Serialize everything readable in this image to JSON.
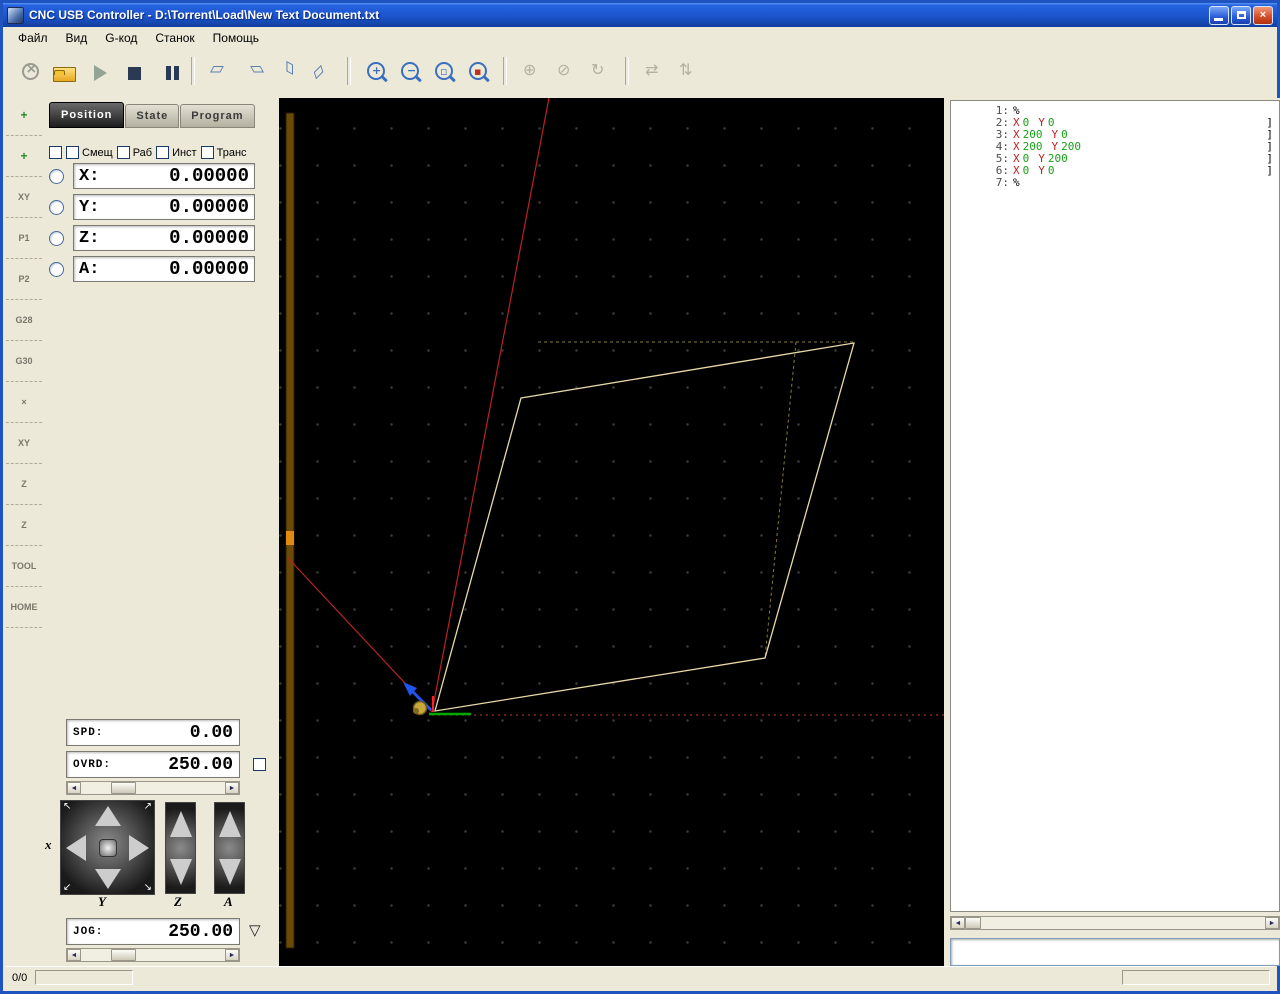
{
  "window": {
    "title": "CNC USB Controller - D:\\Torrent\\Load\\New Text Document.txt"
  },
  "menubar": {
    "items": [
      {
        "name": "menu-file",
        "label": "Файл"
      },
      {
        "name": "menu-view",
        "label": "Вид"
      },
      {
        "name": "menu-gcode",
        "label": "G-код"
      },
      {
        "name": "menu-machine",
        "label": "Станок"
      },
      {
        "name": "menu-help",
        "label": "Помощь"
      }
    ]
  },
  "toolbar": {
    "groups": [
      [
        {
          "name": "estop-icon",
          "kind": "estop",
          "disabled": true
        },
        {
          "name": "open-file-icon",
          "kind": "folder",
          "disabled": false
        },
        {
          "name": "start-icon",
          "kind": "play",
          "disabled": true
        },
        {
          "name": "stop-icon",
          "kind": "stop",
          "disabled": false
        },
        {
          "name": "pause-icon",
          "kind": "pause",
          "disabled": false
        }
      ],
      [
        {
          "name": "view-perspective-icon",
          "kind": "view1",
          "disabled": false
        },
        {
          "name": "view-top-icon",
          "kind": "view2",
          "disabled": false
        },
        {
          "name": "view-front-icon",
          "kind": "view3",
          "disabled": false
        },
        {
          "name": "view-side-icon",
          "kind": "view4",
          "disabled": false
        }
      ],
      [
        {
          "name": "zoom-in-icon",
          "kind": "zoomin",
          "disabled": false
        },
        {
          "name": "zoom-out-icon",
          "kind": "zoomout",
          "disabled": false
        },
        {
          "name": "zoom-window-icon",
          "kind": "zoomwin",
          "disabled": false
        },
        {
          "name": "zoom-tool-icon",
          "kind": "zoomtool",
          "disabled": false
        }
      ],
      [
        {
          "name": "simulate-icon",
          "kind": "g1",
          "disabled": true
        },
        {
          "name": "render-toolpath-icon",
          "kind": "g2",
          "disabled": true
        },
        {
          "name": "rotate-view-icon",
          "kind": "g3",
          "disabled": true
        }
      ],
      [
        {
          "name": "swap-axes-icon",
          "kind": "g4",
          "disabled": true
        },
        {
          "name": "machine-setup-icon",
          "kind": "g5",
          "disabled": true
        }
      ]
    ]
  },
  "sidebar": {
    "items": [
      {
        "name": "sidebar-add-position-1",
        "label": "+",
        "accent": "green"
      },
      {
        "name": "sidebar-add-position-2",
        "label": "+",
        "accent": "green"
      },
      {
        "name": "sidebar-goto-xy",
        "label": "XY"
      },
      {
        "name": "sidebar-goto-p1",
        "label": "P1"
      },
      {
        "name": "sidebar-goto-p2",
        "label": "P2"
      },
      {
        "name": "sidebar-goto-g28",
        "label": "G28"
      },
      {
        "name": "sidebar-goto-g30",
        "label": "G30"
      },
      {
        "name": "sidebar-zero-axes",
        "label": "×"
      },
      {
        "name": "sidebar-zero-xy",
        "label": "XY"
      },
      {
        "name": "sidebar-zero-z",
        "label": "Z"
      },
      {
        "name": "sidebar-measure-z",
        "label": "Z"
      },
      {
        "name": "sidebar-tool",
        "label": "TOOL"
      },
      {
        "name": "sidebar-home",
        "label": "HOME"
      }
    ]
  },
  "panel": {
    "tabs": [
      {
        "name": "tab-position",
        "label": "Position",
        "active": true
      },
      {
        "name": "tab-state",
        "label": "State",
        "active": false
      },
      {
        "name": "tab-program",
        "label": "Program",
        "active": false
      }
    ],
    "checkboxes": [
      {
        "name": "checkbox-main",
        "label": ""
      },
      {
        "name": "checkbox-offset",
        "label": "Смещ"
      },
      {
        "name": "checkbox-work",
        "label": "Раб"
      },
      {
        "name": "checkbox-tool",
        "label": "Инст"
      },
      {
        "name": "checkbox-trans",
        "label": "Транс"
      }
    ],
    "axes": [
      {
        "key": "x",
        "label": "X:",
        "value": "0.00000"
      },
      {
        "key": "y",
        "label": "Y:",
        "value": "0.00000"
      },
      {
        "key": "z",
        "label": "Z:",
        "value": "0.00000"
      },
      {
        "key": "a",
        "label": "A:",
        "value": "0.00000"
      }
    ],
    "spd": {
      "label": "SPD:",
      "value": "0.00"
    },
    "ovrd": {
      "label": "OVRD:",
      "value": "250.00"
    },
    "jog": {
      "label": "JOG:",
      "value": "250.00"
    },
    "jog_axis_labels": {
      "pad_x": "x",
      "pad_y": "Y",
      "z": "Z",
      "a": "A"
    }
  },
  "gcode": {
    "lines": [
      {
        "num": "1:",
        "tokens": [
          {
            "text": "%",
            "color": "plain"
          }
        ],
        "bracket": ""
      },
      {
        "num": "2:",
        "tokens": [
          {
            "text": "X",
            "color": "axis"
          },
          {
            "text": "0",
            "color": "val"
          },
          {
            "text": "Y",
            "color": "axis"
          },
          {
            "text": "0",
            "color": "val"
          }
        ],
        "bracket": "]"
      },
      {
        "num": "3:",
        "tokens": [
          {
            "text": "X",
            "color": "axis"
          },
          {
            "text": "200",
            "color": "val"
          },
          {
            "text": "Y",
            "color": "axis"
          },
          {
            "text": "0",
            "color": "val"
          }
        ],
        "bracket": "]"
      },
      {
        "num": "4:",
        "tokens": [
          {
            "text": "X",
            "color": "axis"
          },
          {
            "text": "200",
            "color": "val"
          },
          {
            "text": "Y",
            "color": "axis"
          },
          {
            "text": "200",
            "color": "val"
          }
        ],
        "bracket": "]"
      },
      {
        "num": "5:",
        "tokens": [
          {
            "text": "X",
            "color": "axis"
          },
          {
            "text": "0",
            "color": "val"
          },
          {
            "text": "Y",
            "color": "axis"
          },
          {
            "text": "200",
            "color": "val"
          }
        ],
        "bracket": "]"
      },
      {
        "num": "6:",
        "tokens": [
          {
            "text": "X",
            "color": "axis"
          },
          {
            "text": "0",
            "color": "val"
          },
          {
            "text": "Y",
            "color": "axis"
          },
          {
            "text": "0",
            "color": "val"
          }
        ],
        "bracket": "]"
      },
      {
        "num": "7:",
        "tokens": [
          {
            "text": "%",
            "color": "plain"
          }
        ],
        "bracket": ""
      }
    ]
  },
  "statusbar": {
    "counter": "0/0"
  },
  "colors": {
    "titlebar": "#1b54cc",
    "viewport_bg": "#000000",
    "toolpath": "#ead9a8",
    "rapid_move": "#cc2222",
    "axis_x_color": "#c02020",
    "value_color": "#18a018",
    "accent_green": "#00aa00",
    "accent_blue": "#2255ee"
  }
}
